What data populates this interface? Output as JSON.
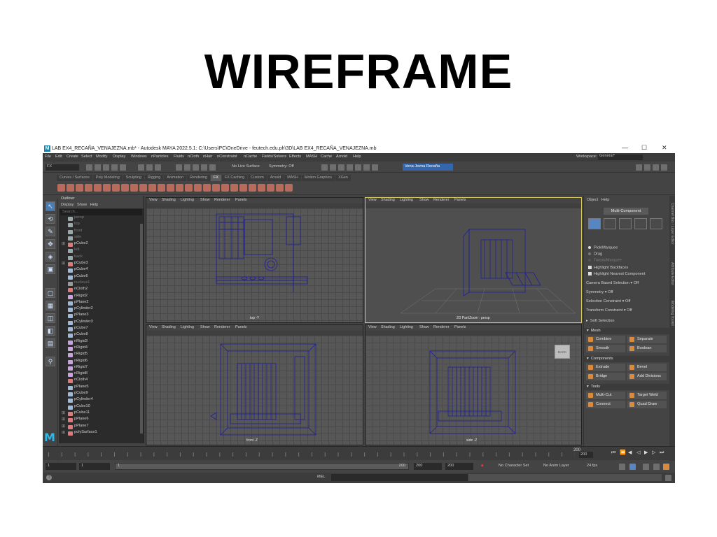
{
  "slide": {
    "title": "WIREFRAME"
  },
  "window": {
    "title": "LAB EX4_RECAÑA_VENAJEZNA.mb* - Autodesk MAYA 2022.5.1: C:\\Users\\PC\\OneDrive - feutech.edu.ph\\3D\\LAB EX4_RECAÑA_VENAJEZNA.mb",
    "app_icon": "M",
    "controls": {
      "minimize": "—",
      "maximize": "☐",
      "close": "✕"
    }
  },
  "menubar": {
    "items": [
      "File",
      "Edit",
      "Create",
      "Select",
      "Modify",
      "Display",
      "Windows",
      "nParticles",
      "Fluids",
      "nCloth",
      "nHair",
      "nConstraint",
      "nCache",
      "Fields/Solvers",
      "Effects",
      "MASH",
      "Cache",
      "Arnold",
      "Help"
    ],
    "workspace_label": "Workspace:",
    "workspace_value": "General*"
  },
  "statusline": {
    "mode": "FX",
    "no_live_surface": "No Live Surface",
    "symmetry": "Symmetry: Off",
    "user": "Vena Jezna Recaña"
  },
  "shelf": {
    "tabs": [
      "Curves / Surfaces",
      "Poly Modeling",
      "Sculpting",
      "Rigging",
      "Animation",
      "Rendering",
      "FX",
      "FX Caching",
      "Custom",
      "Arnold",
      "MASH",
      "Motion Graphics",
      "XGen"
    ],
    "active_tab": "FX"
  },
  "outliner": {
    "title": "Outliner",
    "menu": [
      "Display",
      "Show",
      "Help"
    ],
    "search_placeholder": "Search...",
    "items": [
      {
        "label": "persp",
        "type": "camera",
        "dim": true
      },
      {
        "label": "top",
        "type": "camera",
        "dim": true
      },
      {
        "label": "front",
        "type": "camera",
        "dim": true
      },
      {
        "label": "side",
        "type": "camera",
        "dim": true
      },
      {
        "label": "pCube2",
        "type": "group",
        "dim": false
      },
      {
        "label": "left",
        "type": "camera",
        "dim": true
      },
      {
        "label": "back",
        "type": "camera",
        "dim": true
      },
      {
        "label": "pCube3",
        "type": "group",
        "dim": false
      },
      {
        "label": "pCube4",
        "type": "mesh",
        "dim": false
      },
      {
        "label": "pCube6",
        "type": "mesh",
        "dim": false
      },
      {
        "label": "nucleus1",
        "type": "nucleus",
        "dim": true
      },
      {
        "label": "nCloth2",
        "type": "cloth",
        "dim": false
      },
      {
        "label": "nRigid2",
        "type": "rigid",
        "dim": false
      },
      {
        "label": "pPlane2",
        "type": "mesh",
        "dim": false
      },
      {
        "label": "pCylinder2",
        "type": "mesh",
        "dim": false
      },
      {
        "label": "pPlane3",
        "type": "mesh",
        "dim": false
      },
      {
        "label": "pCylinder3",
        "type": "mesh",
        "dim": false
      },
      {
        "label": "pCube7",
        "type": "mesh",
        "dim": false
      },
      {
        "label": "pCube8",
        "type": "mesh",
        "dim": false
      },
      {
        "label": "nRigid3",
        "type": "rigid",
        "dim": false
      },
      {
        "label": "nRigid4",
        "type": "rigid",
        "dim": false
      },
      {
        "label": "nRigid5",
        "type": "rigid",
        "dim": false
      },
      {
        "label": "nRigid6",
        "type": "rigid",
        "dim": false
      },
      {
        "label": "nRigid7",
        "type": "rigid",
        "dim": false
      },
      {
        "label": "nRigid8",
        "type": "rigid",
        "dim": false
      },
      {
        "label": "nCloth4",
        "type": "cloth",
        "dim": false
      },
      {
        "label": "pPlane5",
        "type": "mesh",
        "dim": false
      },
      {
        "label": "pCube9",
        "type": "mesh",
        "dim": false
      },
      {
        "label": "pCylinder4",
        "type": "mesh",
        "dim": false
      },
      {
        "label": "pCube10",
        "type": "mesh",
        "dim": false
      },
      {
        "label": "pCube11",
        "type": "group",
        "dim": false
      },
      {
        "label": "pPlane6",
        "type": "group",
        "dim": false
      },
      {
        "label": "pPlane7",
        "type": "group",
        "dim": false
      },
      {
        "label": "polySurface1",
        "type": "group",
        "dim": false
      }
    ]
  },
  "viewports": {
    "menu": [
      "View",
      "Shading",
      "Lighting",
      "Show",
      "Renderer",
      "Panels"
    ],
    "top": {
      "label": "top -Y"
    },
    "persp": {
      "label": "2D Pan/Zoom : persp"
    },
    "front": {
      "label": "front -Z"
    },
    "side": {
      "label": "side -Z",
      "viewcube": "BACK"
    }
  },
  "modeling_toolkit": {
    "menu": [
      "Object",
      "Help"
    ],
    "mode": "Multi-Component",
    "selection": {
      "pick_marquee": "Pick/Marquee",
      "drag": "Drag",
      "tweak_marquee": "Tweak/Marquee",
      "highlight_backfaces": "Highlight Backfaces",
      "highlight_nearest": "Highlight Nearest Component"
    },
    "camera_based": {
      "label": "Camera Based Selection",
      "value": "Off"
    },
    "symmetry": {
      "label": "Symmetry",
      "value": "Off"
    },
    "selection_constraint": {
      "label": "Selection Constraint",
      "value": "Off"
    },
    "transform_constraint": {
      "label": "Transform Constraint",
      "value": "Off"
    },
    "soft_selection": "Soft Selection",
    "sections": {
      "mesh": {
        "title": "Mesh",
        "buttons": [
          "Combine",
          "Separate",
          "Smooth",
          "Boolean"
        ]
      },
      "components": {
        "title": "Components",
        "buttons": [
          "Extrude",
          "Bevel",
          "Bridge",
          "Add Divisions"
        ]
      },
      "tools": {
        "title": "Tools",
        "buttons": [
          "Multi-Cut",
          "Target Weld",
          "Connect",
          "Quad Draw"
        ]
      }
    },
    "side_tabs": [
      "Channel Box / Layer Editor",
      "Attribute Editor",
      "Modeling Toolkit"
    ]
  },
  "timeline": {
    "current_frame": "200",
    "end_field": "200",
    "range": {
      "start": "1",
      "playback_start": "1",
      "slider_start": "1",
      "slider_end": "200",
      "playback_end": "200",
      "end": "200"
    },
    "character_set": "No Character Set",
    "anim_layer": "No Anim Layer",
    "fps": "24 fps"
  },
  "commandline": {
    "label": "MEL"
  },
  "colors": {
    "wire": "#1f1f9e",
    "accent": "#5886c2",
    "shelf_icon": "#b86b5a"
  }
}
